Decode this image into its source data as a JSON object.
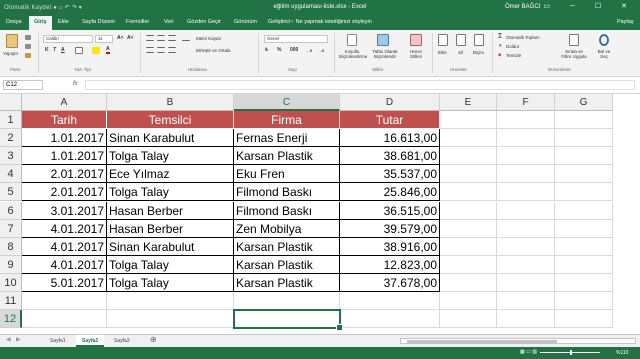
{
  "window": {
    "quick_access": "Otomatik Kaydet  ●  ⌂ ↶ ↷ ▾",
    "title": "eğitim uygulaması-liste.xlsx  -  Excel",
    "user": "Ömer BAĞCI",
    "controls": "▭ ─ ☐ ✕"
  },
  "ribbon_tabs": [
    "Dosya",
    "Giriş",
    "Ekle",
    "Sayfa Düzeni",
    "Formüller",
    "Veri",
    "Gözden Geçir",
    "Görünüm",
    "Geliştirici"
  ],
  "tell_me": "♀ Ne yapmak istediğinizi söyleyin",
  "share_label": "Paylaş",
  "ribbon": {
    "paste": "Yapıştır",
    "font_name": "Calibri",
    "font_size": "11",
    "wrap_text": "Metni Kaydır",
    "merge_center": "Birleştir ve Ortala",
    "number_format": "Genel",
    "conditional_format": "Koşullu Biçimlendirme",
    "format_as_table": "Tablo Olarak Biçimlendir",
    "cell_styles": "Hücre Stilleri",
    "insert": "Ekle",
    "delete": "Sil",
    "format": "Biçim",
    "autosum": "Otomatik Toplam",
    "fill": "Doldur",
    "clear": "Temizle",
    "sort_filter": "Sırala ve Filtre Uygula",
    "find_select": "Bul ve Seç",
    "groups": {
      "clipboard": "Pano",
      "font": "Yazı Tipi",
      "alignment": "Hizalama",
      "number": "Sayı",
      "styles": "Stiller",
      "cells": "Hücreler",
      "editing": "Düzenleme"
    }
  },
  "formula_bar": {
    "name_box": "C12",
    "fx": "fx",
    "value": ""
  },
  "columns": [
    "A",
    "B",
    "C",
    "D",
    "E",
    "F",
    "G"
  ],
  "rows": [
    "1",
    "2",
    "3",
    "4",
    "5",
    "6",
    "7",
    "8",
    "9",
    "10",
    "11",
    "12"
  ],
  "table": {
    "headers": [
      "Tarih",
      "Temsilci",
      "Firma",
      "Tutar"
    ],
    "rows": [
      [
        "1.01.2017",
        "Sinan Karabulut",
        "Fernas Enerji",
        "16.613,00"
      ],
      [
        "1.01.2017",
        "Tolga Talay",
        "Karsan Plastik",
        "38.681,00"
      ],
      [
        "2.01.2017",
        "Ece Yılmaz",
        "Eku Fren",
        "35.537,00"
      ],
      [
        "2.01.2017",
        "Tolga Talay",
        "Filmond Baskı",
        "25.846,00"
      ],
      [
        "3.01.2017",
        "Hasan Berber",
        "Filmond Baskı",
        "36.515,00"
      ],
      [
        "4.01.2017",
        "Hasan Berber",
        "Zen Mobilya",
        "39.579,00"
      ],
      [
        "4.01.2017",
        "Sinan Karabulut",
        "Karsan Plastik",
        "38.916,00"
      ],
      [
        "4.01.2017",
        "Tolga Talay",
        "Karsan Plastik",
        "12.823,00"
      ],
      [
        "5.01.2017",
        "Tolga Talay",
        "Karsan Plastik",
        "37.678,00"
      ]
    ]
  },
  "sheets": [
    "Sayfa1",
    "Sayfa2",
    "Sayfa3"
  ],
  "active_sheet": "Sayfa2",
  "status": {
    "zoom": "%110"
  },
  "colors": {
    "excel_green": "#217346",
    "header_fill": "#c0504d",
    "header_text": "#ffffff"
  }
}
